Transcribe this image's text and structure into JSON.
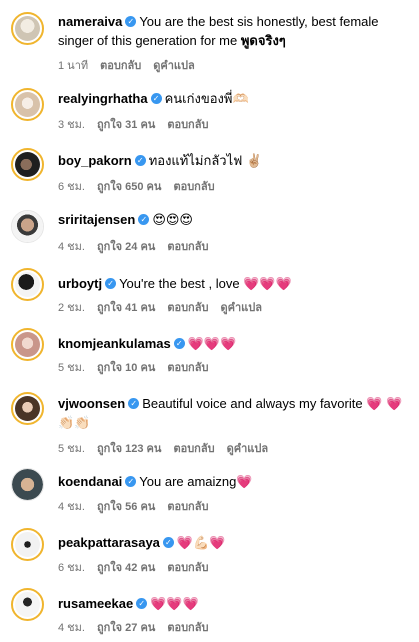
{
  "comments": [
    {
      "username": "nameraiva",
      "text": "You are the best sis honestly, best female singer of this generation for me ",
      "emphasis": "พูดจริงๆ",
      "time": "1 นาที",
      "likes": "",
      "reply": "ตอบกลับ",
      "translate": "ดูคำแปล",
      "avatar_bg": "#d9d3c7"
    },
    {
      "username": "realyingrhatha",
      "text": "คนเก่งของพี่🫶🏻",
      "emphasis": "",
      "time": "3 ชม.",
      "likes": "ถูกใจ 31 คน",
      "reply": "ตอบกลับ",
      "translate": "",
      "avatar_bg": "#e6dcd0"
    },
    {
      "username": "boy_pakorn",
      "text": "ทองแท้ไม่กลัวไฟ ✌🏼",
      "emphasis": "",
      "time": "6 ชม.",
      "likes": "ถูกใจ 650 คน",
      "reply": "ตอบกลับ",
      "translate": "",
      "avatar_bg": "#2b2b2b"
    },
    {
      "username": "sriritajensen",
      "text": "😍😍😍",
      "emphasis": "",
      "time": "4 ชม.",
      "likes": "ถูกใจ 24 คน",
      "reply": "ตอบกลับ",
      "translate": "",
      "avatar_bg": "#dcdcdc"
    },
    {
      "username": "urboytj",
      "text": "You're the best , love 💗💗💗",
      "emphasis": "",
      "time": "2 ชม.",
      "likes": "ถูกใจ 41 คน",
      "reply": "ตอบกลับ",
      "translate": "ดูคำแปล",
      "avatar_bg": "#1c1c1c"
    },
    {
      "username": "knomjeankulamas",
      "text": "💗💗💗",
      "emphasis": "",
      "time": "5 ชม.",
      "likes": "ถูกใจ 10 คน",
      "reply": "ตอบกลับ",
      "translate": "",
      "avatar_bg": "#e8c8c0"
    },
    {
      "username": "vjwoonsen",
      "text": "Beautiful voice and always my favorite 💗 💗👏🏻👏🏻",
      "emphasis": "",
      "time": "5 ชม.",
      "likes": "ถูกใจ 123 คน",
      "reply": "ตอบกลับ",
      "translate": "ดูคำแปล",
      "avatar_bg": "#b89a86"
    },
    {
      "username": "koendanai",
      "text": "You are amaizng💗",
      "emphasis": "",
      "time": "4 ชม.",
      "likes": "ถูกใจ 56 คน",
      "reply": "ตอบกลับ",
      "translate": "",
      "avatar_bg": "#4a5a5e"
    },
    {
      "username": "peakpattarasaya",
      "text": "💗💪🏻💗",
      "emphasis": "",
      "time": "6 ชม.",
      "likes": "ถูกใจ 42 คน",
      "reply": "ตอบกลับ",
      "translate": "",
      "avatar_bg": "#ececec"
    },
    {
      "username": "rusameekae",
      "text": "💗💗💗",
      "emphasis": "",
      "time": "4 ชม.",
      "likes": "ถูกใจ 27 คน",
      "reply": "ตอบกลับ",
      "translate": "",
      "avatar_bg": "#f0f0f0"
    }
  ],
  "colors": {
    "verified": "#3897f0",
    "ring": "#f0b52e",
    "meta": "#737373"
  },
  "icons": {
    "verified": "verified-badge-icon"
  }
}
